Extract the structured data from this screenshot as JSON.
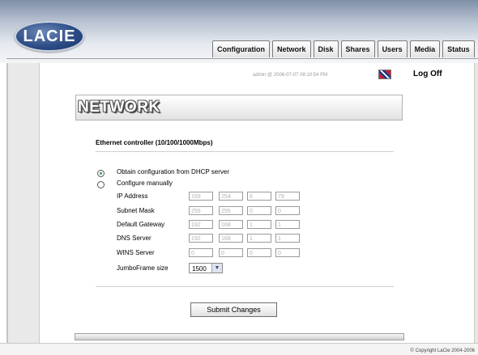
{
  "brand": {
    "logo_text": "LACIE"
  },
  "tabs": [
    {
      "label": "Configuration"
    },
    {
      "label": "Network"
    },
    {
      "label": "Disk"
    },
    {
      "label": "Shares"
    },
    {
      "label": "Users"
    },
    {
      "label": "Media"
    },
    {
      "label": "Status"
    }
  ],
  "session": {
    "info": "admin @ 2006-07-07 08:10:54 PM",
    "logoff": "Log Off"
  },
  "page": {
    "title": "NETWORK"
  },
  "section": {
    "title": "Ethernet controller (10/100/1000Mbps)"
  },
  "options": {
    "dhcp_label": "Obtain configuration from DHCP server",
    "manual_label": "Configure manually",
    "selected": "dhcp"
  },
  "fields": {
    "ip": {
      "label": "IP Address",
      "values": [
        "169",
        "254",
        "6",
        "79"
      ]
    },
    "subnet": {
      "label": "Subnet Mask",
      "values": [
        "255",
        "255",
        "0",
        "0"
      ]
    },
    "gateway": {
      "label": "Default Gateway",
      "values": [
        "192",
        "168",
        "1",
        "1"
      ]
    },
    "dns": {
      "label": "DNS Server",
      "values": [
        "192",
        "168",
        "1",
        "1"
      ]
    },
    "wins": {
      "label": "WINS Server",
      "values": [
        "0",
        "0",
        "0",
        "0"
      ]
    },
    "jumbo": {
      "label": "JumboFrame size",
      "value": "1500"
    }
  },
  "actions": {
    "submit": "Submit Changes"
  },
  "footer": {
    "copyright": "© Copyright LaCie 2004-2006"
  }
}
